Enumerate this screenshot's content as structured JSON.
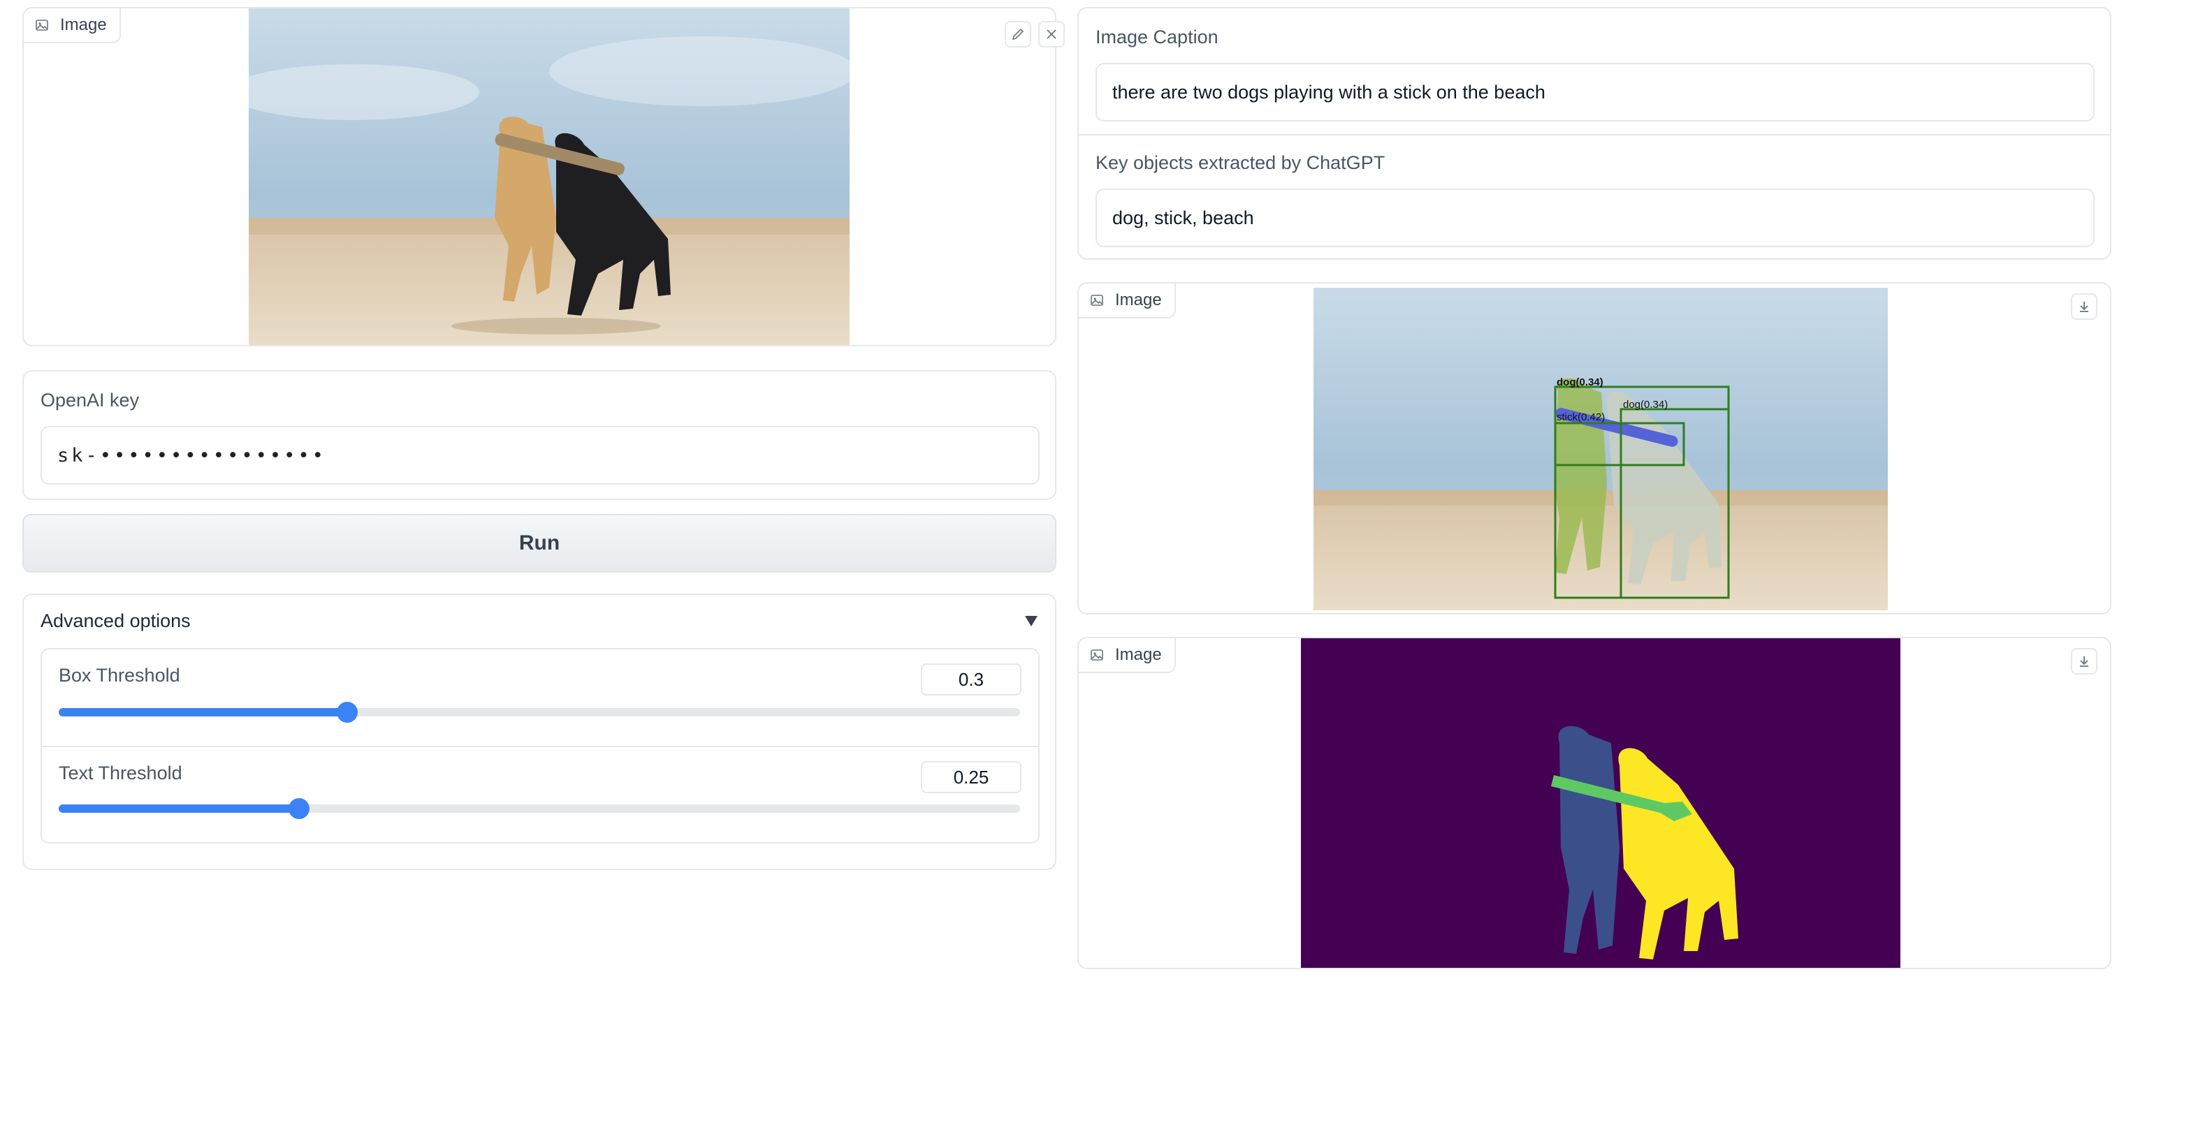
{
  "input_image": {
    "label": "Image"
  },
  "openai": {
    "label": "OpenAI key",
    "value": "sk-••••••••••••••••"
  },
  "run_button": {
    "label": "Run"
  },
  "advanced": {
    "title": "Advanced options",
    "box_threshold": {
      "label": "Box Threshold",
      "value": "0.3",
      "fraction": 0.3
    },
    "text_threshold": {
      "label": "Text Threshold",
      "value": "0.25",
      "fraction": 0.25
    }
  },
  "caption": {
    "label": "Image Caption",
    "value": "there are two dogs playing with a stick on the beach"
  },
  "key_objects": {
    "label": "Key objects extracted by ChatGPT",
    "value": "dog, stick, beach"
  },
  "detection_image": {
    "label": "Image",
    "boxes": [
      {
        "text": "dog(0.34)"
      },
      {
        "text": "dog(0.34)"
      },
      {
        "text": "stick(0.42)"
      }
    ]
  },
  "mask_image": {
    "label": "Image"
  },
  "colors": {
    "accent": "#3b82f6",
    "mask_background": "#440154",
    "mask_dog_left": "#3b4f8b",
    "mask_dog_right": "#fde725",
    "mask_stick": "#5ec962"
  }
}
